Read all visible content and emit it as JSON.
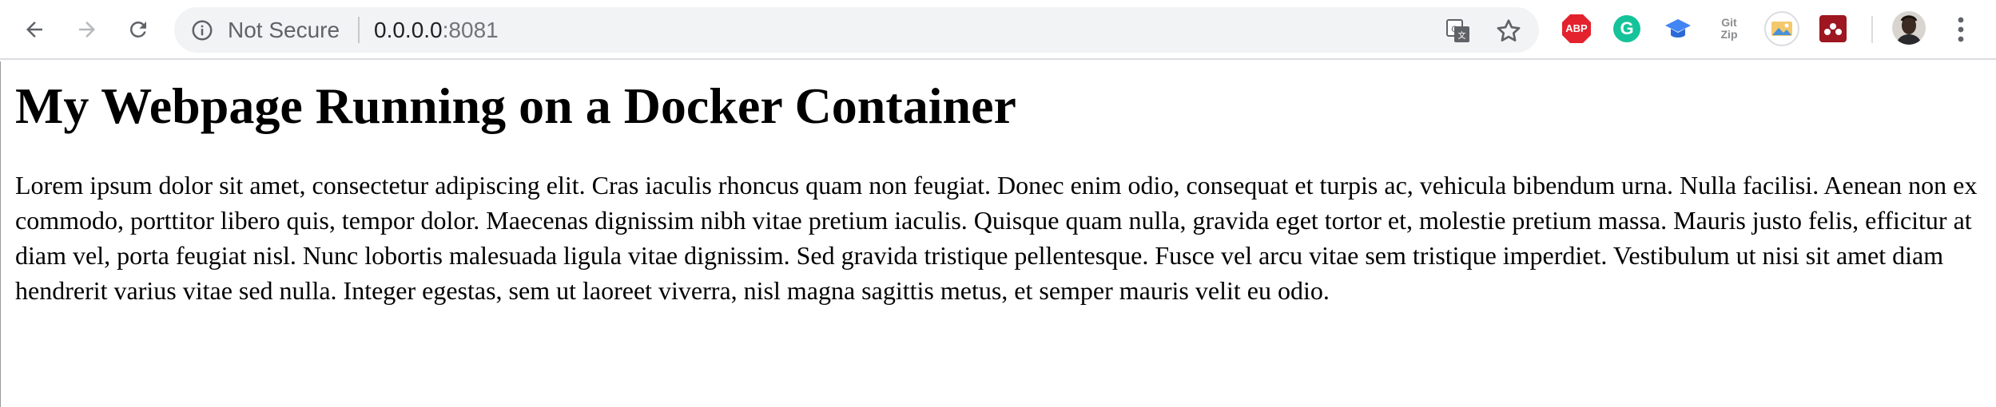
{
  "browser": {
    "security_label": "Not Secure",
    "url_host": "0.0.0.0",
    "url_port": ":8081",
    "icons": {
      "back": "back-arrow-icon",
      "forward": "forward-arrow-icon",
      "reload": "reload-icon",
      "info": "info-icon",
      "translate": "translate-icon",
      "bookmark": "star-icon",
      "menu": "kebab-menu-icon"
    },
    "extensions": {
      "adblock_label": "ABP",
      "grammarly_label": "G",
      "gitzip_line1": "Git",
      "gitzip_line2": "Zip"
    },
    "colors": {
      "adblock": "#e3222e",
      "grammarly": "#15c39a",
      "cap": "#4285f4",
      "mendeley": "#9d1620"
    }
  },
  "page": {
    "heading": "My Webpage Running on a Docker Container",
    "paragraph": "Lorem ipsum dolor sit amet, consectetur adipiscing elit. Cras iaculis rhoncus quam non feugiat. Donec enim odio, consequat et turpis ac, vehicula bibendum urna. Nulla facilisi. Aenean non ex commodo, porttitor libero quis, tempor dolor. Maecenas dignissim nibh vitae pretium iaculis. Quisque quam nulla, gravida eget tortor et, molestie pretium massa. Mauris justo felis, efficitur at diam vel, porta feugiat nisl. Nunc lobortis malesuada ligula vitae dignissim. Sed gravida tristique pellentesque. Fusce vel arcu vitae sem tristique imperdiet. Vestibulum ut nisi sit amet diam hendrerit varius vitae sed nulla. Integer egestas, sem ut laoreet viverra, nisl magna sagittis metus, et semper mauris velit eu odio."
  }
}
